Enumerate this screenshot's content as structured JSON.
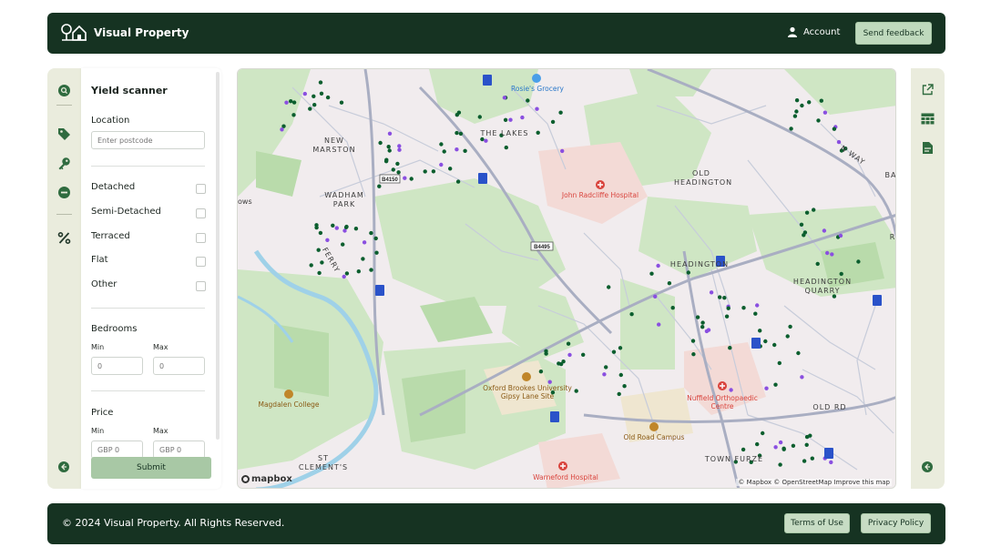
{
  "header": {
    "app_title": "Visual Property",
    "account_label": "Account",
    "feedback_label": "Send feedback"
  },
  "left_rail": {
    "icons": [
      "search-icon",
      "tag-icon",
      "key-icon",
      "minus-circle-icon",
      "percent-icon",
      "arrow-left-circle-icon"
    ]
  },
  "panel": {
    "title": "Yield scanner",
    "location_label": "Location",
    "postcode_placeholder": "Enter postcode",
    "property_types": [
      "Detached",
      "Semi-Detached",
      "Terraced",
      "Flat",
      "Other"
    ],
    "bedrooms_label": "Bedrooms",
    "min_label": "Min",
    "max_label": "Max",
    "bedrooms_min_placeholder": "0",
    "bedrooms_max_placeholder": "0",
    "price_label": "Price",
    "price_min_placeholder": "GBP 0",
    "price_max_placeholder": "GBP 0",
    "submit_label": "Submit"
  },
  "map": {
    "places": {
      "new_marston": "NEW\nMARSTON",
      "the_lakes": "THE LAKES",
      "wadham_park": "WADHAM\nPARK",
      "old_headington": "OLD\nHEADINGTON",
      "headington": "HEADINGTON",
      "headington_quarry": "HEADINGTON\nQUARRY",
      "st_clements": "ST\nCLEMENT'S",
      "town_furze": "TOWN FURZE",
      "old_road": "OLD RD",
      "n_way": "N WAY",
      "ferry": "FERRY",
      "ows": "ows",
      "ba": "BA",
      "r": "R"
    },
    "pois": {
      "rosies_grocery": "Rosie's Grocery",
      "john_radcliffe": "John Radcliffe Hospital",
      "oxford_brookes": "Oxford Brookes University\nGipsy Lane Site",
      "magdalen": "Magdalen College",
      "old_road_campus": "Old Road Campus",
      "nuffield": "Nuffield Orthopaedic\nCentre",
      "warneford": "Warneford Hospital"
    },
    "road_labels": {
      "b4150": "B4150",
      "b4495": "B4495"
    },
    "attribution": "© Mapbox © OpenStreetMap Improve this map",
    "logo_text": "mapbox",
    "colors": {
      "green_dot": "#0b5e2e",
      "purple_dot": "#8a4fe0",
      "hospital": "#d9443d",
      "building": "#2a52c9"
    }
  },
  "right_rail": {
    "icons": [
      "external-link-icon",
      "table-icon",
      "document-icon",
      "arrow-left-circle-icon"
    ]
  },
  "footer": {
    "copyright": "© 2024 Visual Property. All Rights Reserved.",
    "terms_label": "Terms of Use",
    "privacy_label": "Privacy Policy"
  }
}
